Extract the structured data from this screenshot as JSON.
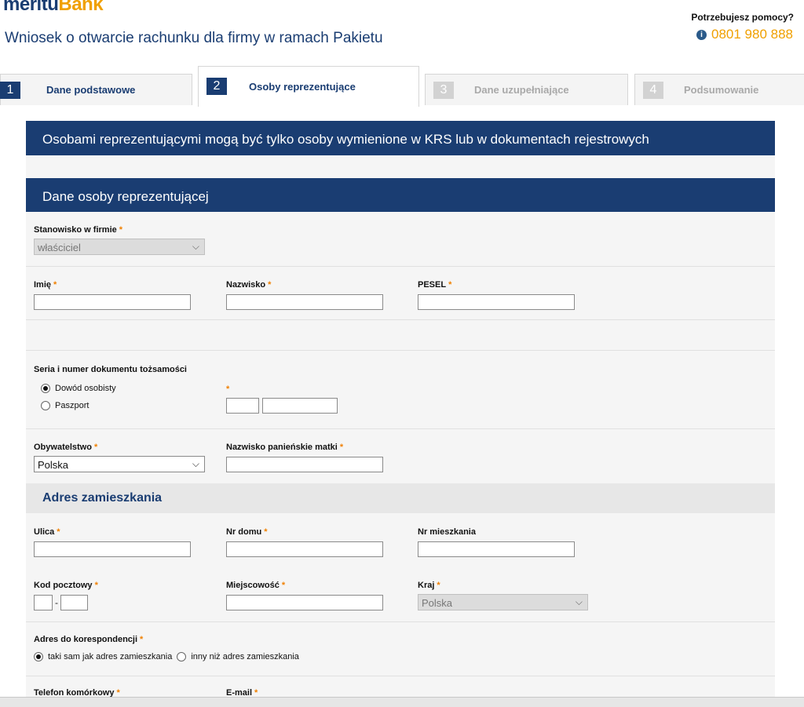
{
  "header": {
    "logo_main": "meritu",
    "logo_accent": "Bank",
    "logo_sup": "",
    "page_title": "Wniosek o otwarcie rachunku dla firmy w ramach Pakietu",
    "help_label": "Potrzebujesz pomocy?",
    "help_phone": "0801 980 888"
  },
  "tabs": [
    {
      "num": "1",
      "label": "Dane podstawowe",
      "state": "done"
    },
    {
      "num": "2",
      "label": "Osoby reprezentujące",
      "state": "active"
    },
    {
      "num": "3",
      "label": "Dane uzupełniające",
      "state": "disabled"
    },
    {
      "num": "4",
      "label": "Podsumowanie",
      "state": "disabled"
    }
  ],
  "info_banner": "Osobami reprezentującymi mogą być tylko osoby wymienione w KRS lub w dokumentach rejestrowych",
  "section_title": "Dane osoby reprezentującej",
  "form": {
    "position_label": "Stanowisko w firmie",
    "position_value": "właściciel",
    "first_name_label": "Imię",
    "last_name_label": "Nazwisko",
    "pesel_label": "PESEL",
    "id_doc_label": "Seria i numer dokumentu tożsamości",
    "id_option_1": "Dowód osobisty",
    "id_option_2": "Paszport",
    "citizenship_label": "Obywatelstwo",
    "citizenship_value": "Polska",
    "mother_name_label": "Nazwisko panieńskie matki",
    "address_header": "Adres zamieszkania",
    "street_label": "Ulica",
    "house_no_label": "Nr domu",
    "flat_no_label": "Nr mieszkania",
    "postal_label": "Kod pocztowy",
    "postal_separator": "-",
    "city_label": "Miejscowość",
    "country_label": "Kraj",
    "country_value": "Polska",
    "corr_label": "Adres do korespondencji",
    "corr_option_1": "taki sam jak adres zamieszkania",
    "corr_option_2": "inny niż adres zamieszkania",
    "phone_label": "Telefon komórkowy",
    "email_label": "E-mail",
    "required_mark": "*"
  }
}
